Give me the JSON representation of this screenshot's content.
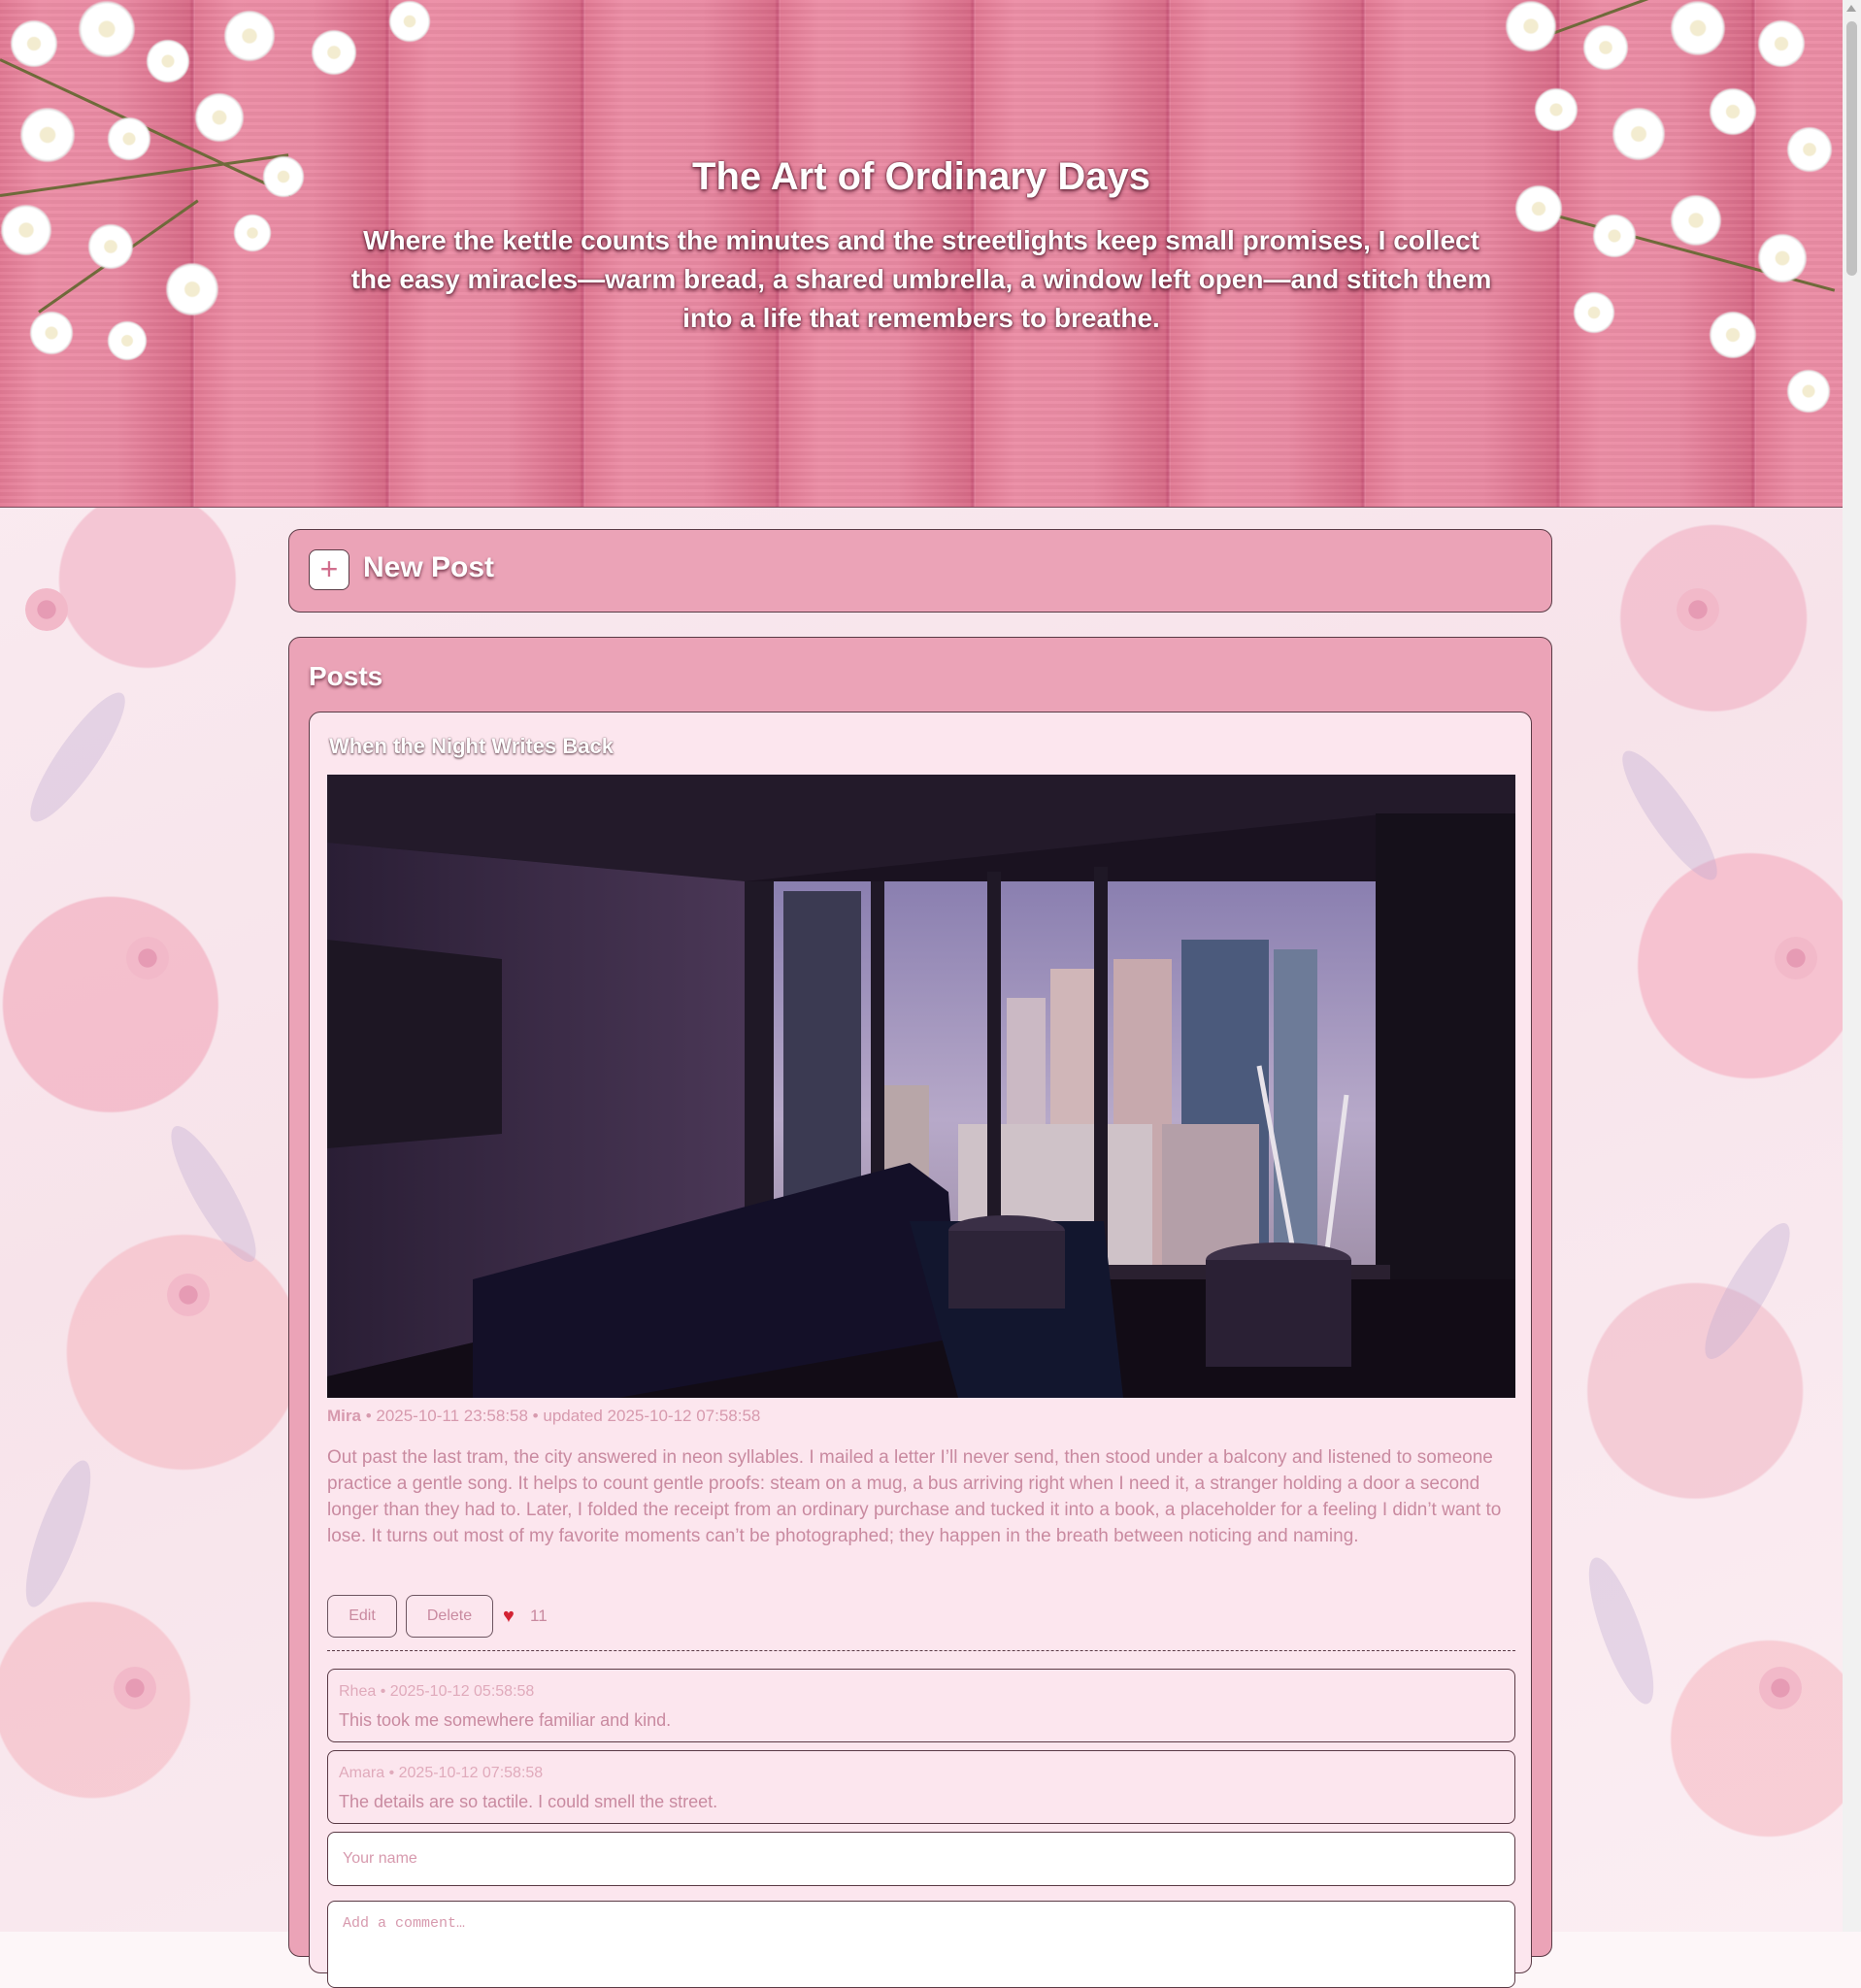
{
  "header": {
    "title": "The Art of Ordinary Days",
    "subtitle": "Where the kettle counts the minutes and the streetlights keep small promises, I collect the easy miracles—warm bread, a shared umbrella, a window left open—and stitch them into a life that remembers to breathe."
  },
  "new_post": {
    "plus_symbol": "+",
    "label": "New Post"
  },
  "posts_section": {
    "heading": "Posts"
  },
  "post": {
    "title": "When the Night Writes Back",
    "author": "Mira",
    "meta": " • 2025-10-11 23:58:58 • updated 2025-10-12 07:58:58",
    "body": "Out past the last tram, the city answered in neon syllables. I mailed a letter I’ll never send, then stood under a balcony and listened to someone practice a gentle song. It helps to count gentle proofs: steam on a mug, a bus arriving right when I need it, a stranger holding a door a second longer than they had to. Later, I folded the receipt from an ordinary purchase and tucked it into a book, a placeholder for a feeling I didn’t want to lose. It turns out most of my favorite moments can’t be photographed; they happen in the breath between noticing and naming.",
    "edit_label": "Edit",
    "delete_label": "Delete",
    "heart_glyph": "♥",
    "like_count": "11",
    "comments": [
      {
        "meta": "Rhea • 2025-10-12 05:58:58",
        "text": "This took me somewhere familiar and kind."
      },
      {
        "meta": "Amara • 2025-10-12 07:58:58",
        "text": "The details are so tactile. I could smell the street."
      }
    ],
    "name_placeholder": "Your name",
    "comment_placeholder": "Add a comment…"
  },
  "colors": {
    "panel": "#eba3b7",
    "card": "#fce6ee",
    "text_muted": "#c98aa0",
    "heart": "#d32334"
  }
}
